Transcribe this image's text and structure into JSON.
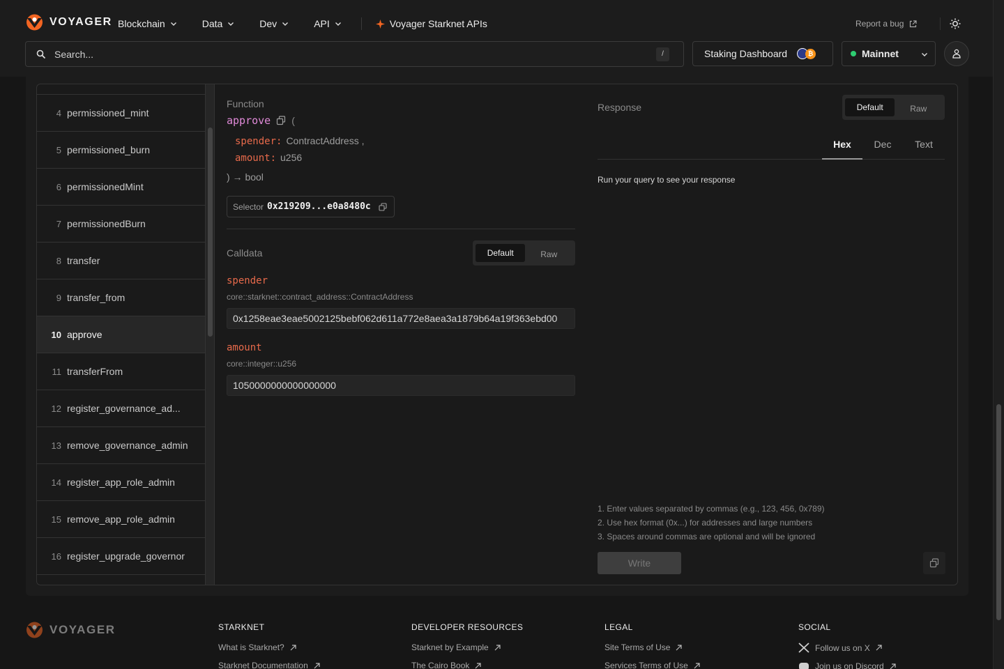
{
  "header": {
    "logo_text": "VOYAGER",
    "nav": [
      "Blockchain",
      "Data",
      "Dev",
      "API"
    ],
    "api_link": "Voyager Starknet APIs",
    "report_bug": "Report a bug",
    "search_placeholder": "Search...",
    "search_shortcut": "/",
    "staking": "Staking Dashboard",
    "btc_badge": "₿",
    "network": "Mainnet"
  },
  "functions": [
    {
      "idx": "4",
      "name": "permissioned_mint"
    },
    {
      "idx": "5",
      "name": "permissioned_burn"
    },
    {
      "idx": "6",
      "name": "permissionedMint"
    },
    {
      "idx": "7",
      "name": "permissionedBurn"
    },
    {
      "idx": "8",
      "name": "transfer"
    },
    {
      "idx": "9",
      "name": "transfer_from"
    },
    {
      "idx": "10",
      "name": "approve"
    },
    {
      "idx": "11",
      "name": "transferFrom"
    },
    {
      "idx": "12",
      "name": "register_governance_ad..."
    },
    {
      "idx": "13",
      "name": "remove_governance_admin"
    },
    {
      "idx": "14",
      "name": "register_app_role_admin"
    },
    {
      "idx": "15",
      "name": "remove_app_role_admin"
    },
    {
      "idx": "16",
      "name": "register_upgrade_governor"
    }
  ],
  "function_panel": {
    "label": "Function",
    "name": "approve",
    "open_paren": "(",
    "args": [
      {
        "name": "spender:",
        "type": "ContractAddress ,"
      },
      {
        "name": "amount:",
        "type": "u256"
      }
    ],
    "return": ") → bool",
    "selector_label": "Selector",
    "selector_value": "0x219209...e0a8480c"
  },
  "calldata": {
    "label": "Calldata",
    "modes": [
      "Default",
      "Raw"
    ],
    "params": [
      {
        "name": "spender",
        "type": "core::starknet::contract_address::ContractAddress",
        "value": "0x1258eae3eae5002125bebf062d611a772e8aea3a1879b64a19f363ebd00"
      },
      {
        "name": "amount",
        "type": "core::integer::u256",
        "value": "1050000000000000000"
      }
    ]
  },
  "response": {
    "label": "Response",
    "modes": [
      "Default",
      "Raw"
    ],
    "formats": [
      "Hex",
      "Dec",
      "Text"
    ],
    "empty": "Run your query to see your response",
    "hints": [
      "1. Enter values separated by commas (e.g., 123, 456, 0x789)",
      "2. Use hex format (0x...) for addresses and large numbers",
      "3. Spaces around commas are optional and will be ignored"
    ],
    "write": "Write"
  },
  "footer": {
    "logo_text": "VOYAGER",
    "columns": [
      {
        "title": "STARKNET",
        "links": [
          "What is Starknet?",
          "Starknet Documentation"
        ]
      },
      {
        "title": "DEVELOPER RESOURCES",
        "links": [
          "Starknet by Example",
          "The Cairo Book"
        ]
      },
      {
        "title": "LEGAL",
        "links": [
          "Site Terms of Use",
          "Services Terms of Use"
        ]
      },
      {
        "title": "SOCIAL",
        "links": [
          "Follow us on X",
          "Join us on Discord"
        ]
      }
    ]
  },
  "colors": {
    "accent": "#e86a4b",
    "function_name": "#e08ad8",
    "network_dot": "#2ecc71",
    "brand_orange": "#f26522"
  }
}
